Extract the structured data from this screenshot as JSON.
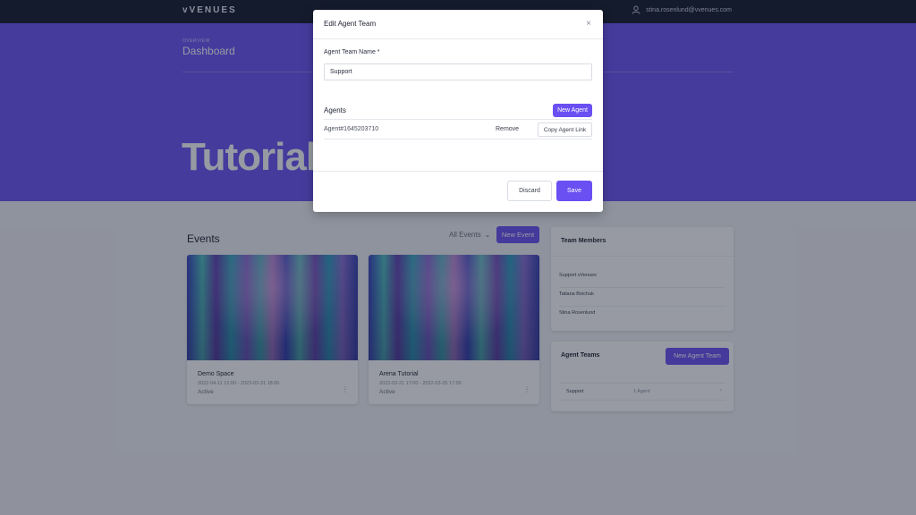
{
  "topbar": {
    "logo": "vVENUES",
    "user_email": "stina.rosenlund@vvenues.com"
  },
  "hero": {
    "overline": "OVERVIEW",
    "title": "Dashboard",
    "big_title": "Tutorial"
  },
  "events": {
    "title": "Events",
    "filter_label": "All Events",
    "new_event_label": "New Event",
    "cards": [
      {
        "name": "Demo Space",
        "date": "2022-04-11 12:00 - 2023-03-31 18:00",
        "status": "Active"
      },
      {
        "name": "Arena Tutorial",
        "date": "2022-03-21 17:00 - 2022-03-25 17:00",
        "status": "Active"
      }
    ]
  },
  "team_members": {
    "title": "Team Members",
    "members": [
      "Support vVenues",
      "Tatiana Boichuk",
      "Stina Rosenlund"
    ]
  },
  "agent_teams": {
    "title": "Agent Teams",
    "new_label": "New Agent Team",
    "row": {
      "name": "Support",
      "count": "1 Agent"
    }
  },
  "modal": {
    "title": "Edit Agent Team",
    "close": "×",
    "name_label": "Agent Team Name *",
    "name_value": "Support",
    "agents_label": "Agents",
    "new_agent_label": "New Agent",
    "agent": {
      "id": "Agent#1645203710",
      "remove_label": "Remove",
      "copy_label": "Copy Agent Link"
    },
    "discard_label": "Discard",
    "save_label": "Save"
  }
}
